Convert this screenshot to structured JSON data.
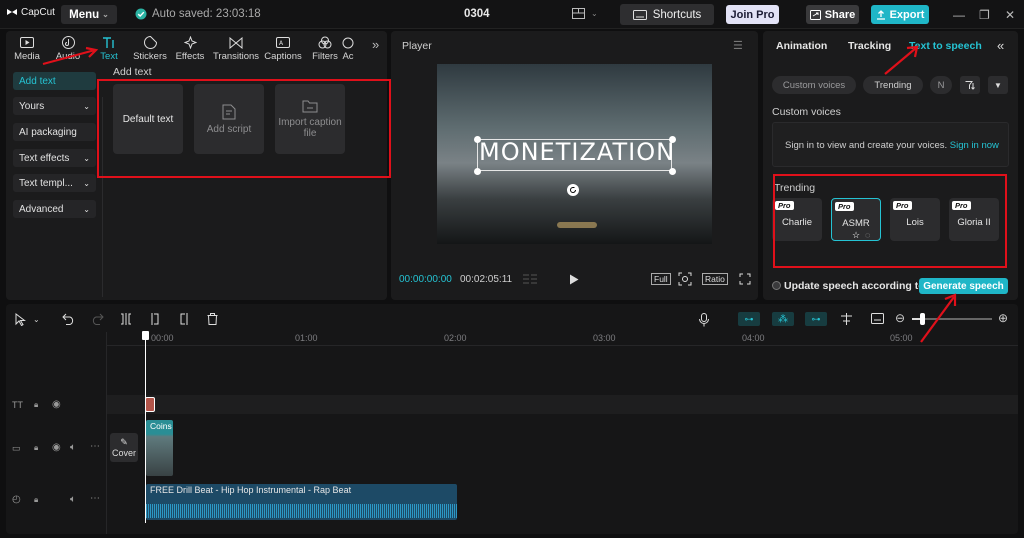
{
  "topbar": {
    "logo_text": "CapCut",
    "menu_label": "Menu",
    "autosave_text": "Auto saved: 23:03:18",
    "project_title": "0304",
    "shortcuts_label": "Shortcuts",
    "joinpro_label": "Join Pro",
    "share_label": "Share",
    "export_label": "Export",
    "accent_color": "#1fb6c7"
  },
  "tool_tabs": [
    {
      "label": "Media",
      "icon": "media-icon"
    },
    {
      "label": "Audio",
      "icon": "audio-icon"
    },
    {
      "label": "Text",
      "icon": "text-icon",
      "active": true
    },
    {
      "label": "Stickers",
      "icon": "sticker-icon"
    },
    {
      "label": "Effects",
      "icon": "effects-icon"
    },
    {
      "label": "Transitions",
      "icon": "transitions-icon"
    },
    {
      "label": "Captions",
      "icon": "captions-icon"
    },
    {
      "label": "Filters",
      "icon": "filters-icon"
    },
    {
      "label": "Ac",
      "icon": "adjust-icon"
    }
  ],
  "sidebar": {
    "items": [
      {
        "label": "Add text",
        "active": true
      },
      {
        "label": "Yours"
      },
      {
        "label": "AI packaging"
      },
      {
        "label": "Text effects"
      },
      {
        "label": "Text templ..."
      },
      {
        "label": "Advanced"
      }
    ]
  },
  "add_text": {
    "heading": "Add text",
    "cards": [
      "Default text",
      "Add script",
      "Import caption file"
    ]
  },
  "player": {
    "title": "Player",
    "overlay_text": "MONETIZATION",
    "current_time": "00:00:00:00",
    "duration": "00:02:05:11",
    "full_label": "Full",
    "ratio_label": "Ratio"
  },
  "right_panel": {
    "tabs": [
      "Animation",
      "Tracking",
      "Text to speech"
    ],
    "chips": [
      "Custom voices",
      "Trending",
      "N"
    ],
    "custom_voices_heading": "Custom voices",
    "signin_text": "Sign in to view and create your voices.",
    "signin_link": "Sign in now",
    "trending_heading": "Trending",
    "pro_badge": "Pro",
    "voices": [
      "Charlie",
      "ASMR",
      "Lois",
      "Gloria II"
    ],
    "update_speech_label": "Update speech according to",
    "generate_label": "Generate speech"
  },
  "timeline": {
    "ruler": [
      "00:00",
      "01:00",
      "02:00",
      "03:00",
      "04:00",
      "05:00"
    ],
    "cover_label": "Cover",
    "video_clip_label": "Coins",
    "audio_clip_label": "FREE Drill Beat - Hip Hop Instrumental - Rap Beat"
  }
}
